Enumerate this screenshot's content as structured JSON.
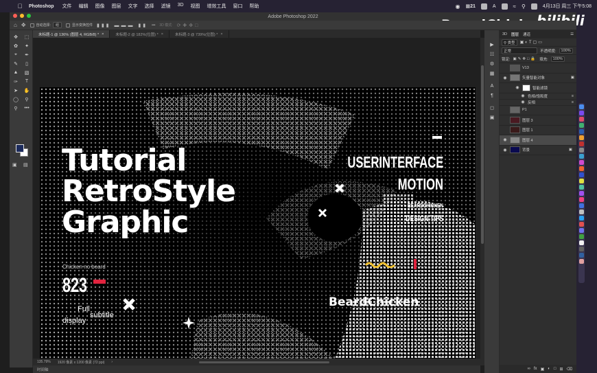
{
  "menubar": {
    "app": "Photoshop",
    "items": [
      "文件",
      "编辑",
      "图像",
      "图层",
      "文字",
      "选择",
      "滤镜",
      "3D",
      "视图",
      "增效工具",
      "窗口",
      "帮助"
    ],
    "battery": "21",
    "datetime": "4月13日 周三 下午5:08"
  },
  "window": {
    "title": "Adobe Photoshop 2022"
  },
  "watermark": {
    "channel": "BeardChicken",
    "logo": "bilibili"
  },
  "options": {
    "auto_select": "自动选择:",
    "auto_select_value": "组",
    "show_transform": "显示变换控件",
    "mode3d": "3D 模式:"
  },
  "tabs": [
    {
      "label": "未标题-1 @ 136% (图层 4, RGB/8) *",
      "active": true
    },
    {
      "label": "未标题-2 @ 182%(位图) *",
      "active": false
    },
    {
      "label": "未标题-3 @ 739%(位图) *",
      "active": false
    }
  ],
  "canvas": {
    "title_lines": [
      "Tutorial",
      "RetroStyle",
      "Graphic"
    ],
    "right_lines": [
      "USERINTERFACE",
      "MOTION"
    ],
    "beardchicken_small": "BEARDCHICKEN",
    "design_tips": "DESIGN TIPS",
    "chicken": "Chicken no beard",
    "number": "823",
    "full": "Full",
    "subtitle": "subtitle",
    "display": "display",
    "brand": "BeardChicken"
  },
  "status": {
    "zoom": "135.79%",
    "doc": "1920 像素 x 1200 像素 (72 ppi)"
  },
  "timeline": "时间轴",
  "layers_panel": {
    "tabs": [
      "3D",
      "图层",
      "通道"
    ],
    "filter": "类型",
    "blend": "正常",
    "opacity_label": "不透明度:",
    "opacity": "100%",
    "lock": "锁定:",
    "fill_label": "填充:",
    "fill": "100%",
    "layers": [
      {
        "name": "V13",
        "eye": false,
        "active": false
      },
      {
        "name": "矢量智能对象",
        "eye": true,
        "active": false
      },
      {
        "name": "智能滤镜",
        "eye": true,
        "active": false
      },
      {
        "name": "色相/饱和度",
        "eye": true,
        "active": false
      },
      {
        "name": "反相",
        "eye": true,
        "active": false
      },
      {
        "name": "P1",
        "eye": false,
        "active": false
      },
      {
        "name": "图层 3",
        "eye": false,
        "active": false
      },
      {
        "name": "图层 1",
        "eye": false,
        "active": false
      },
      {
        "name": "图层 4",
        "eye": true,
        "active": true
      },
      {
        "name": "背景",
        "eye": true,
        "active": false
      }
    ]
  },
  "colors": {
    "foreground": "#1c2b5c",
    "background": "#ffffff",
    "accent_red": "#e0233e",
    "accent_yellow": "#f2c230"
  }
}
